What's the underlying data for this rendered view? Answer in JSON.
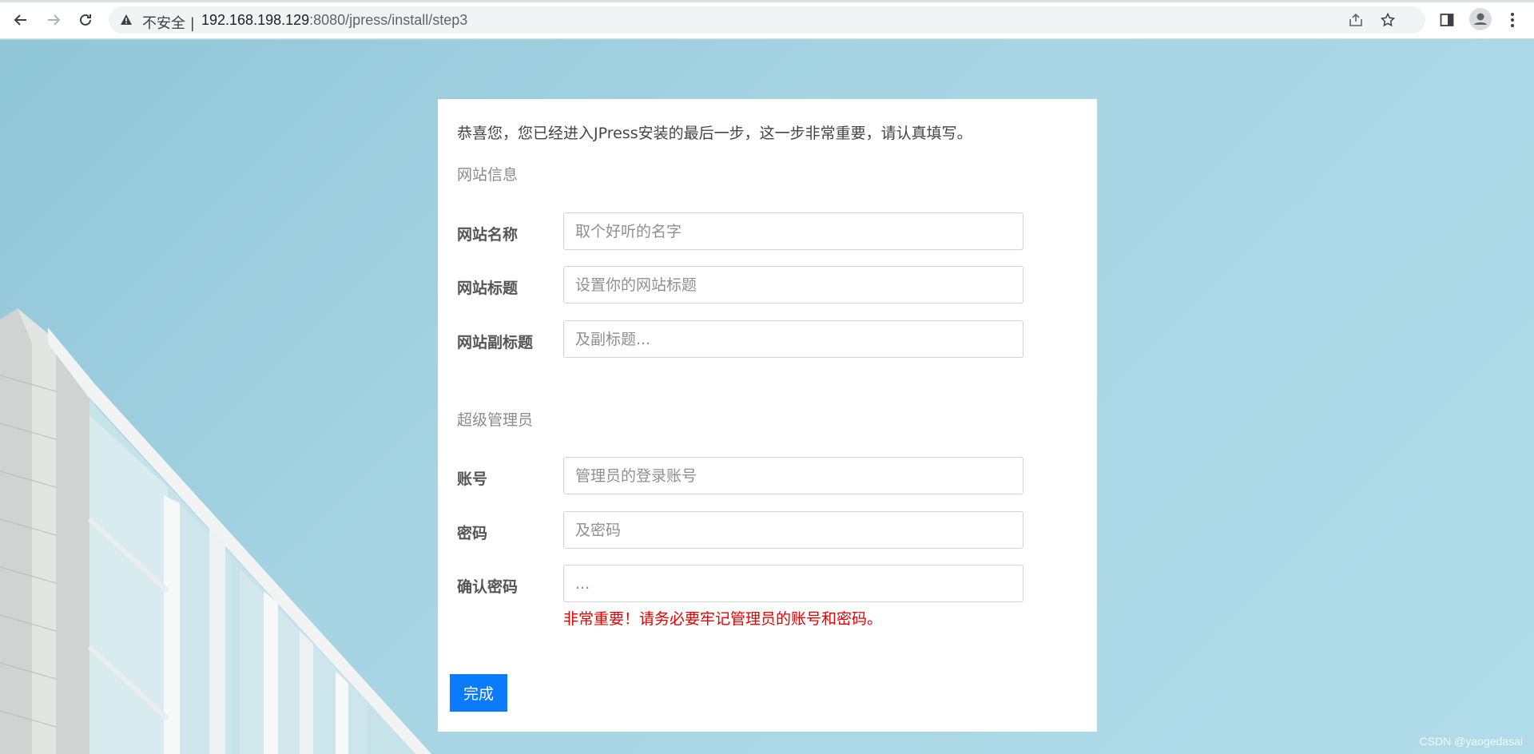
{
  "browser": {
    "security_label": "不安全 |",
    "url_host": "192.168.198.129",
    "url_rest": ":8080/jpress/install/step3",
    "icons": [
      "back-icon",
      "forward-icon",
      "reload-icon",
      "warning-icon",
      "share-icon",
      "star-icon",
      "side-panel-icon",
      "profile-icon",
      "menu-icon"
    ]
  },
  "install": {
    "intro": "恭喜您，您已经进入JPress安装的最后一步，这一步非常重要，请认真填写。",
    "site_section": "网站信息",
    "site_name_label": "网站名称",
    "site_name_placeholder": "取个好听的名字",
    "site_title_label": "网站标题",
    "site_title_placeholder": "设置你的网站标题",
    "site_subtitle_label": "网站副标题",
    "site_subtitle_placeholder": "及副标题...",
    "admin_section": "超级管理员",
    "account_label": "账号",
    "account_placeholder": "管理员的登录账号",
    "password_label": "密码",
    "password_placeholder": "及密码",
    "confirm_label": "确认密码",
    "confirm_placeholder": "...",
    "warning": "非常重要！请务必要牢记管理员的账号和密码。",
    "finish_button": "完成"
  },
  "watermark": "CSDN @yaogedasai",
  "colors": {
    "primary_button": "#0a7bff",
    "warning_text": "#e60000",
    "background_sky": "#a9d7e6"
  }
}
